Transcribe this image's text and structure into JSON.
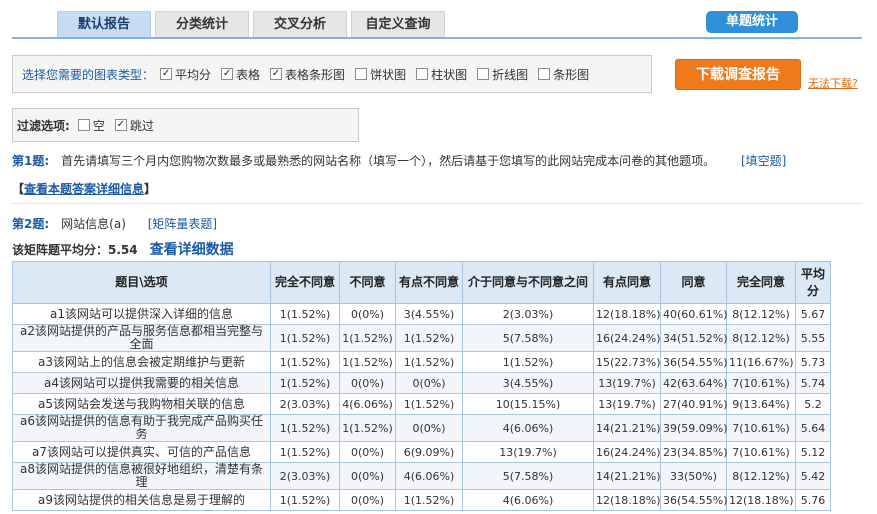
{
  "tabs": [
    "默认报告",
    "分类统计",
    "交叉分析",
    "自定义查询"
  ],
  "single_stat_label": "单题统计",
  "chart_types": {
    "label": "选择您需要的图表类型：",
    "options": [
      {
        "label": "平均分",
        "checked": true
      },
      {
        "label": "表格",
        "checked": true
      },
      {
        "label": "表格条形图",
        "checked": true
      },
      {
        "label": "饼状图",
        "checked": false
      },
      {
        "label": "柱状图",
        "checked": false
      },
      {
        "label": "折线图",
        "checked": false
      },
      {
        "label": "条形图",
        "checked": false
      }
    ]
  },
  "download_label": "下载调查报告",
  "cant_download_label": "无法下载?",
  "filter": {
    "label": "过滤选项:",
    "options": [
      {
        "label": "空",
        "checked": false
      },
      {
        "label": "跳过",
        "checked": true
      }
    ]
  },
  "q1": {
    "num": "第1题:",
    "text": "首先请填写三个月内您购物次数最多或最熟悉的网站名称（填写一个），然后请基于您填写的此网站完成本问卷的其他题项。",
    "type": "[填空题]",
    "detail_open": "【",
    "detail_link": "查看本题答案详细信息",
    "detail_close": "】"
  },
  "q2": {
    "num": "第2题:",
    "text": "网站信息(a)",
    "type": "[矩阵量表题]",
    "avg_label": "该矩阵题平均分：5.54",
    "more_link": "查看详细数据"
  },
  "table": {
    "headers": [
      "题目\\选项",
      "完全不同意",
      "不同意",
      "有点不同意",
      "介于同意与不同意之间",
      "有点同意",
      "同意",
      "完全同意",
      "平均分"
    ],
    "rows": [
      [
        "a1该网站可以提供深入详细的信息",
        "1(1.52%)",
        "0(0%)",
        "3(4.55%)",
        "2(3.03%)",
        "12(18.18%)",
        "40(60.61%)",
        "8(12.12%)",
        "5.67"
      ],
      [
        "a2该网站提供的产品与服务信息都相当完整与全面",
        "1(1.52%)",
        "1(1.52%)",
        "1(1.52%)",
        "5(7.58%)",
        "16(24.24%)",
        "34(51.52%)",
        "8(12.12%)",
        "5.55"
      ],
      [
        "a3该网站上的信息会被定期维护与更新",
        "1(1.52%)",
        "1(1.52%)",
        "1(1.52%)",
        "1(1.52%)",
        "15(22.73%)",
        "36(54.55%)",
        "11(16.67%)",
        "5.73"
      ],
      [
        "a4该网站可以提供我需要的相关信息",
        "1(1.52%)",
        "0(0%)",
        "0(0%)",
        "3(4.55%)",
        "13(19.7%)",
        "42(63.64%)",
        "7(10.61%)",
        "5.74"
      ],
      [
        "a5该网站会发送与我购物相关联的信息",
        "2(3.03%)",
        "4(6.06%)",
        "1(1.52%)",
        "10(15.15%)",
        "13(19.7%)",
        "27(40.91%)",
        "9(13.64%)",
        "5.2"
      ],
      [
        "a6该网站提供的信息有助于我完成产品购买任务",
        "1(1.52%)",
        "1(1.52%)",
        "0(0%)",
        "4(6.06%)",
        "14(21.21%)",
        "39(59.09%)",
        "7(10.61%)",
        "5.64"
      ],
      [
        "a7该网站可以提供真实、可信的产品信息",
        "1(1.52%)",
        "0(0%)",
        "6(9.09%)",
        "13(19.7%)",
        "16(24.24%)",
        "23(34.85%)",
        "7(10.61%)",
        "5.12"
      ],
      [
        "a8该网站提供的信息被很好地组织，清楚有条理",
        "2(3.03%)",
        "0(0%)",
        "4(6.06%)",
        "5(7.58%)",
        "14(21.21%)",
        "33(50%)",
        "8(12.12%)",
        "5.42"
      ],
      [
        "a9该网站提供的相关信息是易于理解的",
        "1(1.52%)",
        "0(0%)",
        "1(1.52%)",
        "4(6.06%)",
        "12(18.18%)",
        "36(54.55%)",
        "12(18.18%)",
        "5.76"
      ]
    ]
  }
}
